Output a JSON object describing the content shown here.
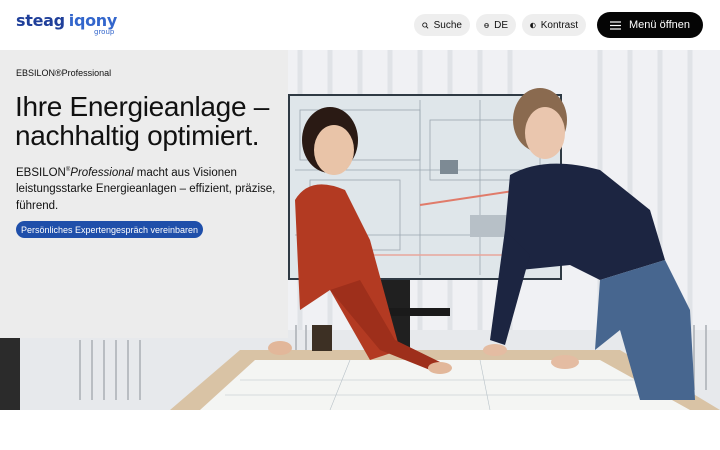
{
  "header": {
    "logo_primary": "steag",
    "logo_secondary": "iqony",
    "logo_tagline": "group",
    "search_label": "Suche",
    "search_icon": "search-icon",
    "language_label": "DE",
    "language_icon": "globe-icon",
    "contrast_label": "Kontrast",
    "contrast_icon": "contrast-icon",
    "menu_label": "Menü öffnen",
    "menu_icon": "hamburger-icon"
  },
  "hero": {
    "product_line": "EBSILON®Professional",
    "headline": "Ihre Energieanlage – nachhaltig optimiert.",
    "description_brand": "EBSILON",
    "description_reg": "®",
    "description_brand_italic": "Professional",
    "description_rest": " macht aus Visionen leistungsstarke Energieanlagen – effizient, präzise, führend.",
    "cta_label": "Persönliches Expertengespräch vereinbaren",
    "image_subject": "two-women-reviewing-engineering-plans"
  },
  "colors": {
    "brand_dark_blue": "#1f3f9a",
    "brand_blue": "#3366cc",
    "cta_blue": "#1f4faa",
    "panel_gray": "#ececec",
    "menu_black": "#050505"
  }
}
